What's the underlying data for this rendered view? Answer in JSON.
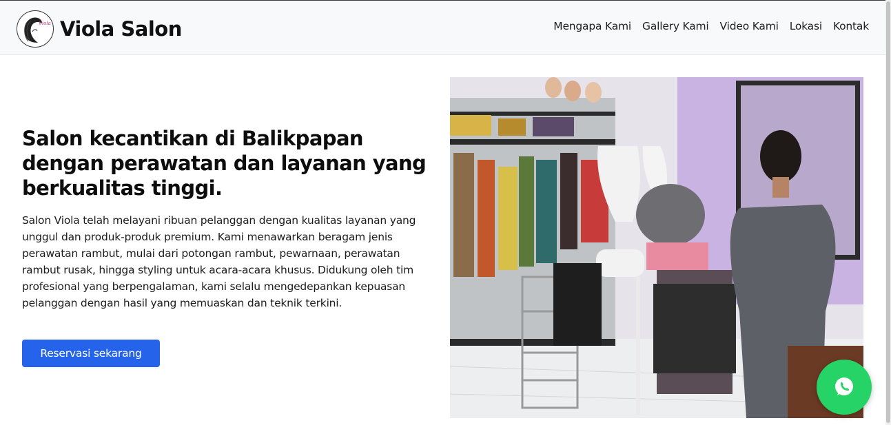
{
  "navbar": {
    "brand_name": "Viola Salon",
    "logo_text": "Viola",
    "links": [
      "Mengapa Kami",
      "Gallery Kami",
      "Video Kami",
      "Lokasi",
      "Kontak"
    ]
  },
  "hero": {
    "title": "Salon kecantikan di Balikpapan dengan perawatan dan layanan yang berkualitas tinggi.",
    "description": "Salon Viola telah melayani ribuan pelanggan dengan kualitas layanan yang unggul dan produk-produk premium. Kami menawarkan beragam jenis perawatan rambut, mulai dari potongan rambut, pewarnaan, perawatan rambut rusak, hingga styling untuk acara-acara khusus. Didukung oleh tim profesional yang berpengalaman, kami selalu mengedepankan kepuasan pelanggan dengan hasil yang memuaskan dan teknik terkini.",
    "cta_label": "Reservasi sekarang"
  },
  "colors": {
    "primary": "#2563eb",
    "whatsapp": "#25d366",
    "navbar_bg": "#f8f9fa"
  },
  "icons": {
    "floating_button": "whatsapp-icon"
  }
}
